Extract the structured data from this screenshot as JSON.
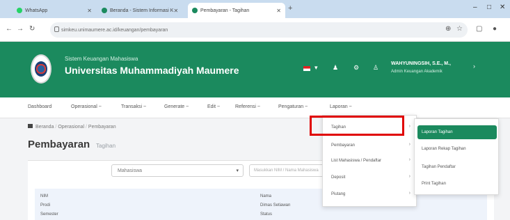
{
  "browser": {
    "tabs": [
      {
        "label": "WhatsApp",
        "color": "#25d366"
      },
      {
        "label": "Beranda - Sistem Informasi K",
        "color": "#1b8a5e"
      },
      {
        "label": "Pembayaran - Tagihan",
        "color": "#1b8a5e"
      }
    ],
    "url": "simkeu.unimaumere.ac.id/keuangan/pembayaran"
  },
  "header": {
    "org_top": "Sistem Keuangan Mahasiswa",
    "org_name": "Universitas Muhammadiyah Maumere",
    "user_name": "WAHYUNINGSIH, S.E., M.,",
    "user_role": "Admin Keuangan Akademik"
  },
  "menu": [
    "Dashboard",
    "Operasional ~",
    "Transaksi ~",
    "Generate ~",
    "Edit ~",
    "Referensi ~",
    "Pengaturan ~",
    "Laporan ~"
  ],
  "breadcrumb": {
    "home": "Beranda",
    "mid": "Operasional",
    "current": "Pembayaran"
  },
  "page": {
    "title": "Pembayaran",
    "subtitle": "Tagihan"
  },
  "filters": {
    "select_value": "Mahasiswa",
    "search_placeholder": "Masukkan NIM / Nama Mahasiswa"
  },
  "table": {
    "col1_rows": [
      "NIM",
      "Prodi",
      "Semester"
    ],
    "col2_rows": [
      "Nama",
      "Dimas Setiawan",
      "Status"
    ]
  },
  "dropdown1": {
    "items": [
      "Tagihan",
      "Pembayaran",
      "List Mahasiswa / Pendaftar",
      "Deposit",
      "Piutang"
    ]
  },
  "dropdown2": {
    "active": "Laporan Tagihan",
    "items": [
      "Laporan Rekap Tagihan",
      "Tagihan Pendaftar",
      "Print Tagihan"
    ]
  },
  "colors": {
    "brand": "#1b8a5e",
    "highlight": "#e00000"
  }
}
